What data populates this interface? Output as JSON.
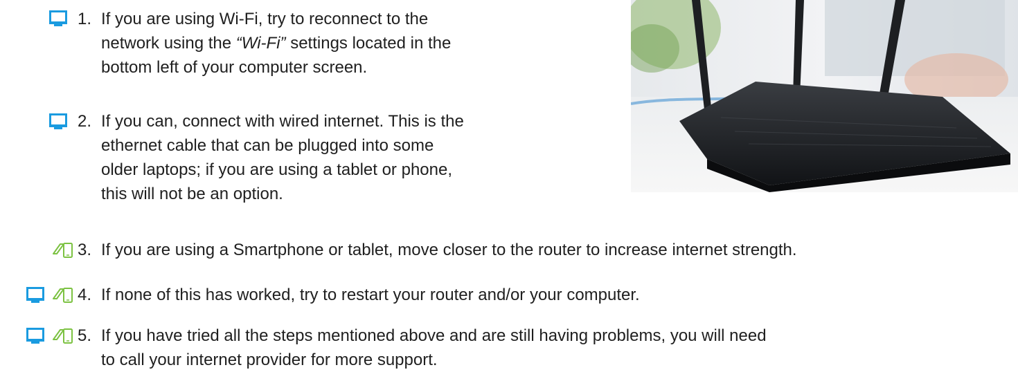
{
  "icons": {
    "computer": "desktop-monitor-icon",
    "mobile": "phone-tablet-icon"
  },
  "colors": {
    "accent_blue": "#1a9be0",
    "accent_green": "#7cc242",
    "text": "#1f1f1f"
  },
  "steps": [
    {
      "number": "1.",
      "text_before": "If you are using Wi-Fi, try to reconnect to the\nnetwork using the ",
      "text_emphasis": "“Wi-Fi”",
      "text_after": " settings located in the\nbottom left of your computer screen.",
      "icons": [
        "computer"
      ]
    },
    {
      "number": "2.",
      "text": "If you can, connect with wired internet. This is the\nethernet cable that can be plugged into some\nolder laptops; if you are using a tablet or phone,\nthis will not be an option.",
      "icons": [
        "computer"
      ]
    },
    {
      "number": "3.",
      "text": "If you are using a Smartphone or tablet, move closer to the router to increase internet strength.",
      "icons": [
        "mobile"
      ]
    },
    {
      "number": "4.",
      "text": "If none of this has worked, try to restart your router and/or your computer.",
      "icons": [
        "computer",
        "mobile"
      ]
    },
    {
      "number": "5.",
      "text": "If you have tried all the steps mentioned above and are still having problems, you will need\nto call your internet provider for more support.",
      "icons": [
        "computer",
        "mobile"
      ]
    }
  ]
}
